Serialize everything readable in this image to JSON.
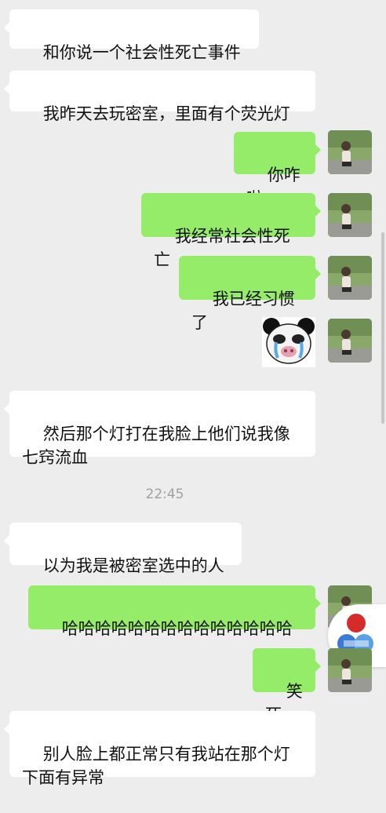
{
  "messages": [
    {
      "text": "和你说一个社会性死亡事件"
    },
    {
      "text": "我昨天去玩密室，里面有个荧光灯"
    },
    {
      "text": "你咋啦"
    },
    {
      "text": "我经常社会性死亡"
    },
    {
      "text": "我已经习惯了"
    },
    {
      "text": "然后那个灯打在我脸上他们说我像\n七窍流血"
    },
    {
      "text": "以为我是被密室选中的人"
    },
    {
      "text": "哈哈哈哈哈哈哈哈哈哈哈哈哈哈"
    },
    {
      "text": "笑死"
    },
    {
      "text": "别人脸上都正常只有我站在那个灯\n下面有异常"
    }
  ],
  "timestamp": "22:45",
  "icons": {
    "avatar": "user-avatar-icon",
    "sticker": "crying-panda-sticker",
    "badge": "floating-app-badge-icon"
  },
  "colors": {
    "background": "#ededed",
    "incoming": "#ffffff",
    "outgoing": "#95ec69"
  }
}
